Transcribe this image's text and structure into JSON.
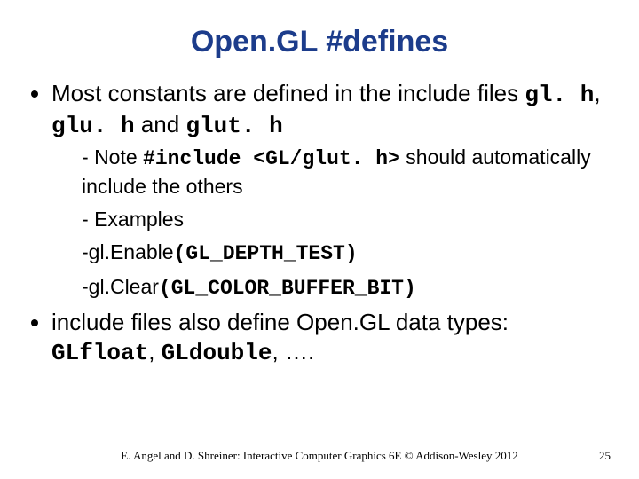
{
  "title": "Open.GL #defines",
  "bullet1": {
    "pre": "Most constants are defined in the include files ",
    "c1": "gl. h",
    "sep1": ", ",
    "c2": "glu. h",
    "mid": " and ",
    "c3": "glut. h"
  },
  "sub1": {
    "pre": "Note ",
    "code": "#include <GL/glut. h>",
    "post": " should automatically include the others"
  },
  "sub2": "Examples",
  "sub3a": "gl.Enable",
  "sub3b": "(GL_DEPTH_TEST)",
  "sub4a": "gl.Clear",
  "sub4b": "(GL_COLOR_BUFFER_BIT)",
  "bullet2": {
    "pre": "include files also define Open.GL data types: ",
    "c1": "GLfloat",
    "sep1": ", ",
    "c2": "GLdouble",
    "post": ", …."
  },
  "footer": "E. Angel and D. Shreiner: Interactive Computer Graphics 6E © Addison-Wesley 2012",
  "page": "25"
}
